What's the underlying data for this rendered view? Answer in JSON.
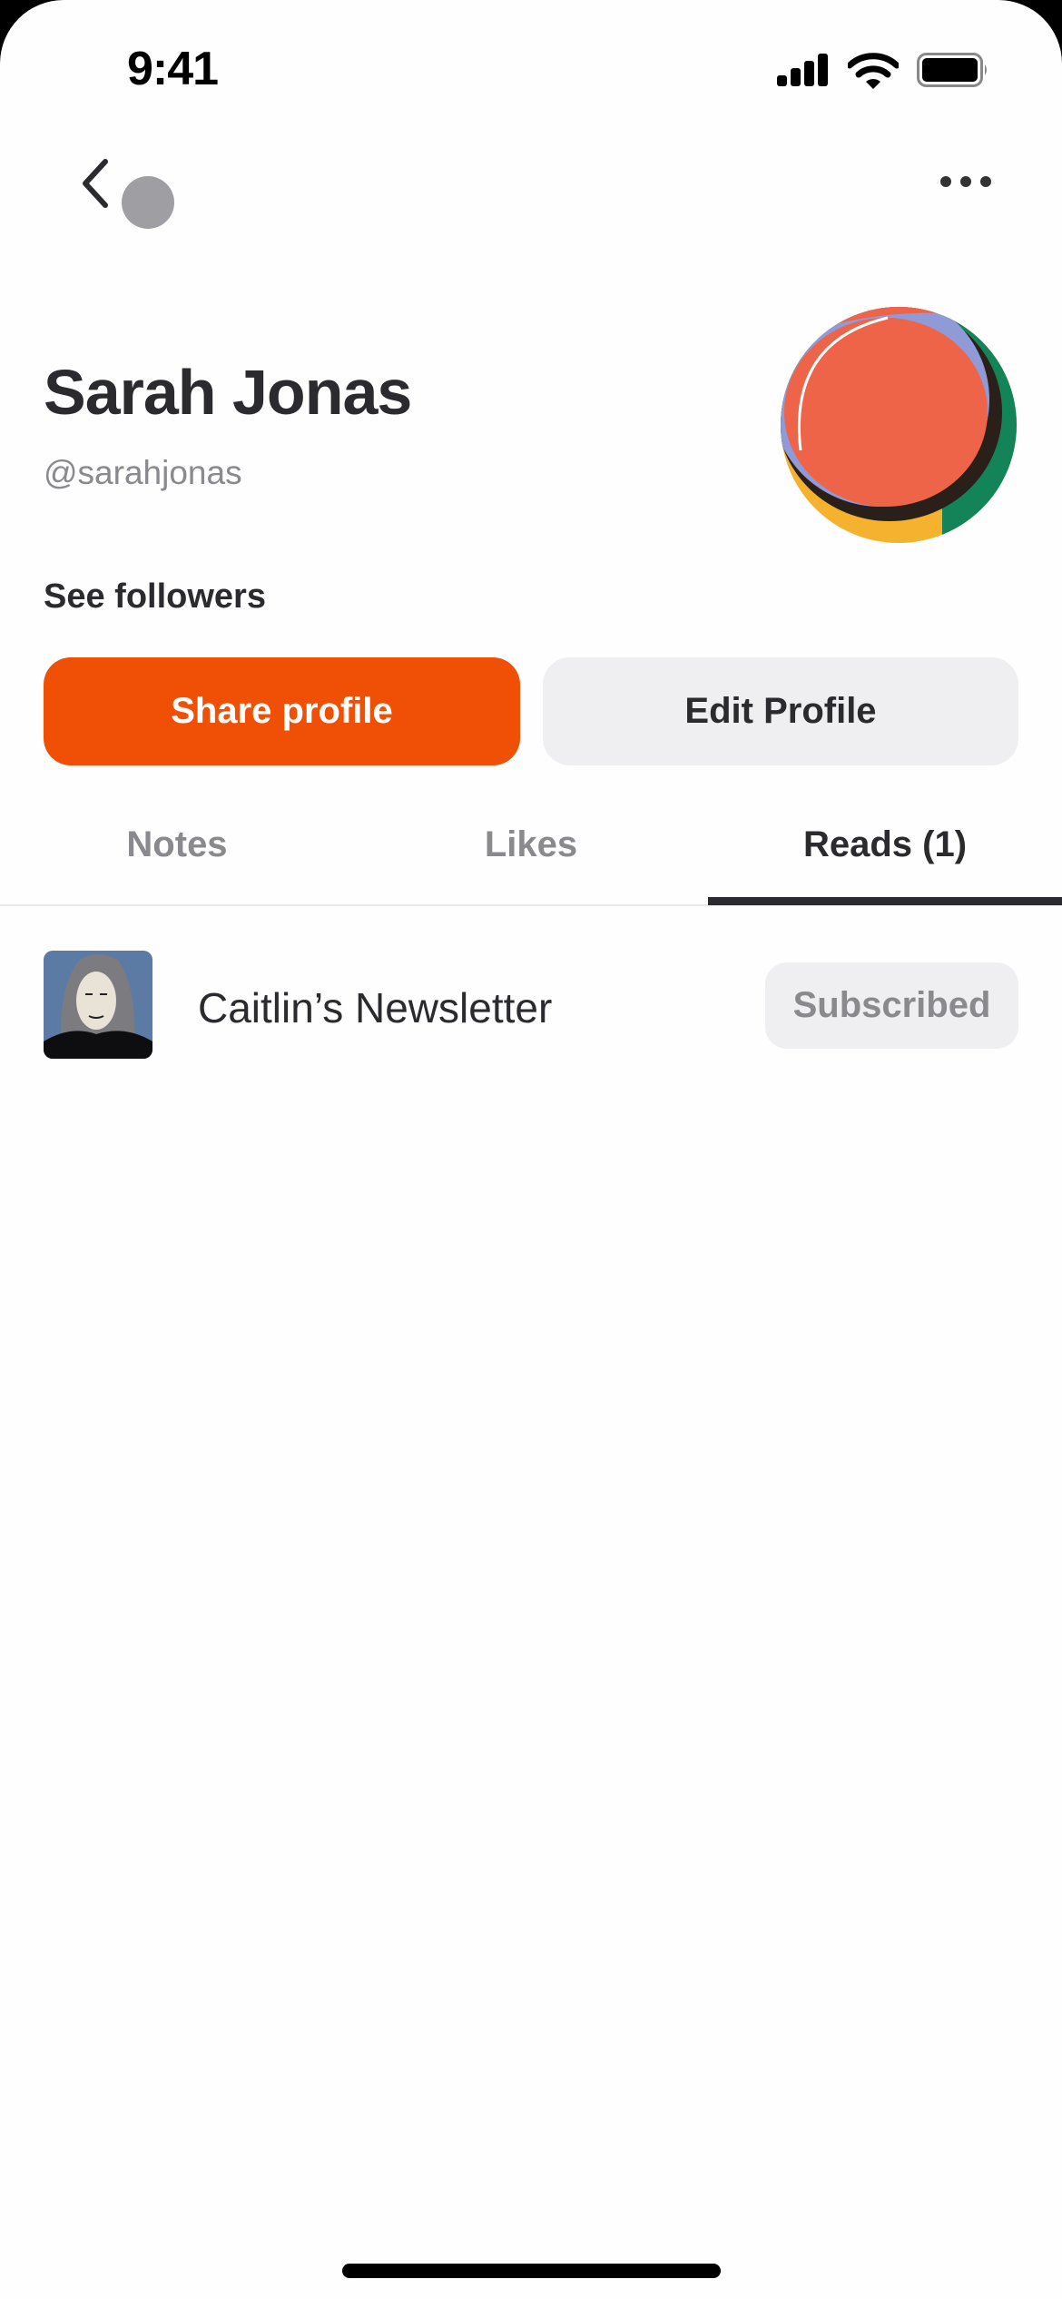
{
  "status_bar": {
    "time": "9:41",
    "icons": [
      "cellular-signal-icon",
      "wifi-icon",
      "battery-icon"
    ]
  },
  "nav": {
    "back_icon": "chevron-left-icon",
    "more_icon": "ellipsis-icon"
  },
  "profile": {
    "name": "Sarah Jonas",
    "handle": "@sarahjonas",
    "see_followers": "See followers",
    "avatar_colors": [
      "#ee6449",
      "#8f9ad6",
      "#2b1f1a",
      "#f4b22e",
      "#138358"
    ]
  },
  "actions": {
    "share_label": "Share profile",
    "edit_label": "Edit Profile",
    "accent": "#f05005"
  },
  "tabs": [
    {
      "label": "Notes",
      "active": false
    },
    {
      "label": "Likes",
      "active": false
    },
    {
      "label": "Reads (1)",
      "active": true
    }
  ],
  "reads": [
    {
      "title": "Caitlin’s Newsletter",
      "status": "Subscribed"
    }
  ]
}
